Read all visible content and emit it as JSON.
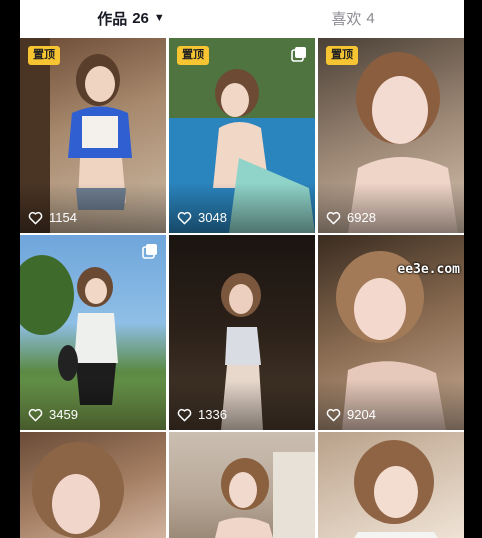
{
  "tabs": {
    "works_label": "作品",
    "works_count": "26",
    "likes_label": "喜欢",
    "likes_count": "4"
  },
  "pinned_label": "置顶",
  "icons": {
    "dropdown": "caret-down-icon",
    "like": "heart-outline-icon",
    "album": "multi-image-icon"
  },
  "grid": [
    {
      "likes": "1154",
      "pinned": true,
      "multi": false
    },
    {
      "likes": "3048",
      "pinned": true,
      "multi": true
    },
    {
      "likes": "6928",
      "pinned": true,
      "multi": false
    },
    {
      "likes": "3459",
      "pinned": false,
      "multi": true
    },
    {
      "likes": "1336",
      "pinned": false,
      "multi": false
    },
    {
      "likes": "9204",
      "pinned": false,
      "multi": false
    },
    {
      "likes": "",
      "pinned": false,
      "multi": false
    },
    {
      "likes": "",
      "pinned": false,
      "multi": false
    },
    {
      "likes": "",
      "pinned": false,
      "multi": false
    }
  ],
  "watermark": "ee3e.com",
  "colors": {
    "pin_badge": "#f6c531",
    "active_tab": "#161823",
    "inactive_tab": "#8a8b91"
  }
}
